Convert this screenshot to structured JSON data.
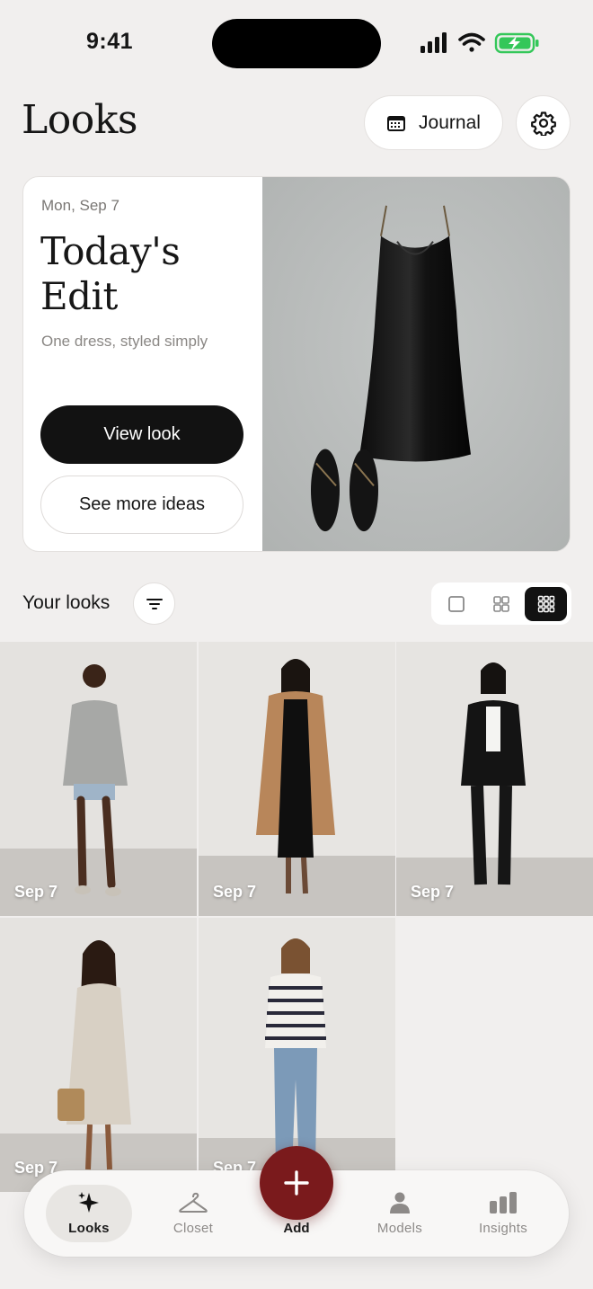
{
  "status": {
    "time": "9:41"
  },
  "header": {
    "title": "Looks",
    "journal_label": "Journal"
  },
  "edit": {
    "date": "Mon, Sep 7",
    "title": "Today's Edit",
    "subtitle": "One dress, styled simply",
    "view_label": "View look",
    "ideas_label": "See more ideas"
  },
  "looks": {
    "label": "Your looks",
    "tiles": [
      {
        "date": "Sep 7",
        "outfit": "grey sweatshirt and denim shorts"
      },
      {
        "date": "Sep 7",
        "outfit": "camel coat over black slip dress"
      },
      {
        "date": "Sep 7",
        "outfit": "black suit with white tee"
      },
      {
        "date": "Sep 7",
        "outfit": "floral day dress with basket bag"
      },
      {
        "date": "Sep 7",
        "outfit": "striped long-sleeve top and jeans"
      }
    ]
  },
  "tabbar": {
    "looks": "Looks",
    "closet": "Closet",
    "add": "Add",
    "models": "Models",
    "insights": "Insights"
  },
  "colors": {
    "accent": "#7a1a1c",
    "background": "#f1efee",
    "primary_button": "#121212"
  }
}
